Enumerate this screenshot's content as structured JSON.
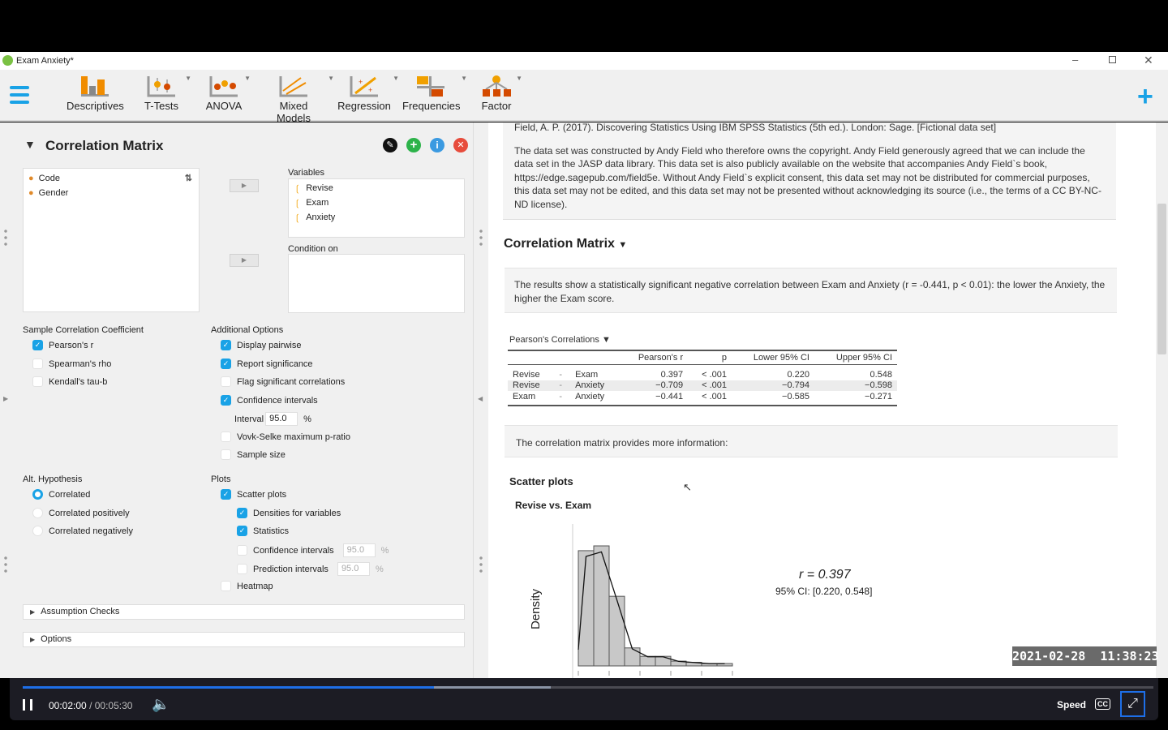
{
  "window": {
    "title": "Exam Anxiety*",
    "controls": [
      "minimize",
      "restore",
      "close"
    ]
  },
  "toolbar": {
    "items": [
      {
        "label": "Descriptives",
        "icon": "descriptives-icon"
      },
      {
        "label": "T-Tests",
        "icon": "t-tests-icon"
      },
      {
        "label": "ANOVA",
        "icon": "anova-icon"
      },
      {
        "label": "Mixed Models",
        "icon": "mixed-models-icon"
      },
      {
        "label": "Regression",
        "icon": "regression-icon"
      },
      {
        "label": "Frequencies",
        "icon": "frequencies-icon"
      },
      {
        "label": "Factor",
        "icon": "factor-icon"
      }
    ],
    "accent": "#19a2e6"
  },
  "analysis": {
    "title": "Correlation Matrix",
    "available_vars": [
      "Code",
      "Gender"
    ],
    "variables_label": "Variables",
    "variables": [
      "Revise",
      "Exam",
      "Anxiety"
    ],
    "condition_label": "Condition on",
    "sample_coef": {
      "title": "Sample Correlation Coefficient",
      "options": [
        {
          "label": "Pearson's r",
          "checked": true
        },
        {
          "label": "Spearman's rho",
          "checked": false
        },
        {
          "label": "Kendall's tau-b",
          "checked": false
        }
      ]
    },
    "additional": {
      "title": "Additional Options",
      "options": [
        {
          "label": "Display pairwise",
          "checked": true
        },
        {
          "label": "Report significance",
          "checked": true
        },
        {
          "label": "Flag significant correlations",
          "checked": false
        },
        {
          "label": "Confidence intervals",
          "checked": true
        }
      ],
      "interval_label": "Interval",
      "interval_value": "95.0",
      "percent": "%",
      "options2": [
        {
          "label": "Vovk-Selke maximum p-ratio",
          "checked": false
        },
        {
          "label": "Sample size",
          "checked": false
        }
      ]
    },
    "hypothesis": {
      "title": "Alt. Hypothesis",
      "options": [
        {
          "label": "Correlated",
          "selected": true
        },
        {
          "label": "Correlated positively",
          "selected": false
        },
        {
          "label": "Correlated negatively",
          "selected": false
        }
      ]
    },
    "plots": {
      "title": "Plots",
      "scatter": "Scatter plots",
      "densities": "Densities for variables",
      "statistics": "Statistics",
      "ci": "Confidence intervals",
      "ci_value": "95.0",
      "pi": "Prediction intervals",
      "pi_value": "95.0",
      "percent": "%",
      "heatmap": "Heatmap"
    },
    "sections": [
      "Assumption Checks",
      "Options"
    ]
  },
  "results": {
    "reference": "Field, A. P. (2017). Discovering Statistics Using IBM SPSS Statistics (5th ed.). London: Sage. [Fictional data set]",
    "copyright": "The data set was constructed by Andy Field who therefore owns the copyright. Andy Field generously agreed that we can include the data set in the JASP data library. This data set is also publicly available on the website that accompanies Andy Field`s book, https://edge.sagepub.com/field5e. Without Andy Field`s explicit consent, this data set may not be distributed for commercial purposes, this data set may not be edited, and this data set may not be presented without acknowledging its source (i.e., the terms of a CC BY-NC-ND license).",
    "heading": "Correlation Matrix",
    "summary": "The results show a statistically significant negative correlation between Exam and Anxiety (r = -0.441, p < 0.01): the lower the Anxiety, the higher the Exam score.",
    "table": {
      "title": "Pearson's Correlations",
      "headers": [
        "",
        "",
        "",
        "Pearson's r",
        "p",
        "Lower 95% CI",
        "Upper 95% CI"
      ],
      "rows": [
        [
          "Revise",
          "-",
          "Exam",
          "0.397",
          "< .001",
          "0.220",
          "0.548"
        ],
        [
          "Revise",
          "-",
          "Anxiety",
          "−0.709",
          "< .001",
          "−0.794",
          "−0.598"
        ],
        [
          "Exam",
          "-",
          "Anxiety",
          "−0.441",
          "< .001",
          "−0.585",
          "−0.271"
        ]
      ]
    },
    "note": "The correlation matrix provides more information:",
    "scatter_heading": "Scatter plots",
    "plot_title": "Revise vs. Exam",
    "ylabel": "Density",
    "r_label": "r = 0.397",
    "ci_label": "95% CI: [0.220, 0.548]",
    "histogram_density": [
      0.96,
      1.0,
      0.58,
      0.15,
      0.08,
      0.08,
      0.04,
      0.03,
      0.02,
      0.02
    ]
  },
  "timestamp": "2021-02-28  11:38:23",
  "video": {
    "current": "00:02:00",
    "separator": "/",
    "duration": "00:05:30",
    "played_fraction": 0.364,
    "buffered_fraction": 0.467,
    "speed_label": "Speed",
    "cc": "CC"
  }
}
